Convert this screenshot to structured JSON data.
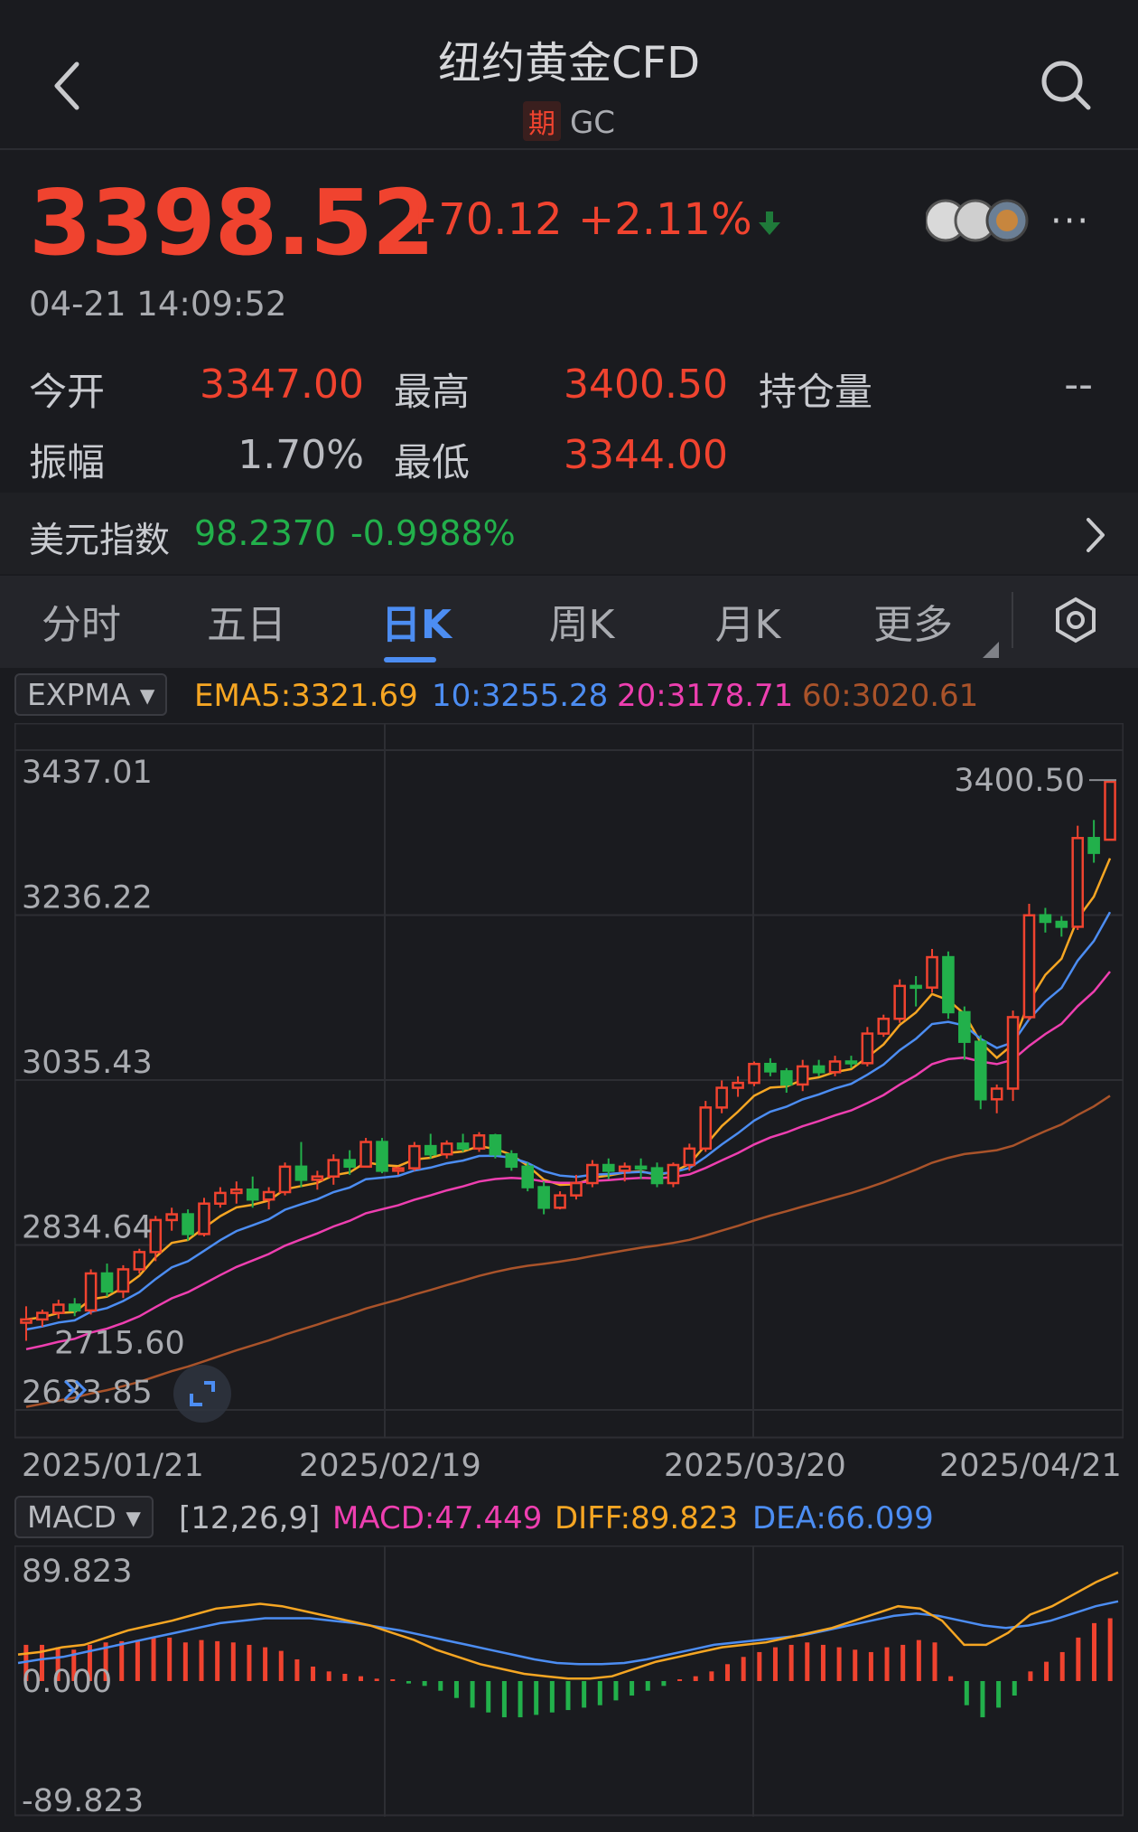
{
  "header": {
    "title": "纽约黄金CFD",
    "tag": "期",
    "code": "GC"
  },
  "quote": {
    "price": "3398.52",
    "change": "+70.12",
    "change_pct": "+2.11%",
    "time": "04-21 14:09:52",
    "more": "···"
  },
  "stats": {
    "open_label": "今开",
    "open": "3347.00",
    "high_label": "最高",
    "high": "3400.50",
    "oi_label": "持仓量",
    "oi": "--",
    "amp_label": "振幅",
    "amp": "1.70%",
    "low_label": "最低",
    "low": "3344.00"
  },
  "dxy": {
    "label": "美元指数",
    "value": "98.2370",
    "change": "-0.9988%"
  },
  "tabs": [
    {
      "label": "分时"
    },
    {
      "label": "五日"
    },
    {
      "label": "日K"
    },
    {
      "label": "周K"
    },
    {
      "label": "月K"
    },
    {
      "label": "更多"
    }
  ],
  "colors": {
    "up": "#f0432f",
    "down": "#22b04b",
    "accent": "#4c8df2",
    "ema5": "#f6a623",
    "ema10": "#4c8df2",
    "ema20": "#ee3fb0",
    "ema60": "#a9532a"
  },
  "expma": {
    "selector": "EXPMA",
    "ema5": "EMA5:3321.69",
    "ema10": "10:3255.28",
    "ema20": "20:3178.71",
    "ema60": "60:3020.61"
  },
  "chart_data": [
    {
      "type": "candlestick",
      "ylim": [
        2633.85,
        3437.01
      ],
      "y_ticks": [
        "3437.01",
        "3236.22",
        "3035.43",
        "2834.64",
        "2633.85"
      ],
      "x_ticks": [
        "2025/01/21",
        "2025/02/19",
        "2025/03/20",
        "2025/04/21"
      ],
      "max_label": "3400.50",
      "min_label": "2715.60",
      "candles": [
        [
          2740,
          2760,
          2718,
          2744
        ],
        [
          2744,
          2756,
          2735,
          2752
        ],
        [
          2752,
          2768,
          2745,
          2762
        ],
        [
          2762,
          2770,
          2748,
          2755
        ],
        [
          2755,
          2805,
          2750,
          2800
        ],
        [
          2800,
          2812,
          2772,
          2778
        ],
        [
          2778,
          2810,
          2770,
          2805
        ],
        [
          2805,
          2830,
          2800,
          2826
        ],
        [
          2826,
          2870,
          2815,
          2865
        ],
        [
          2865,
          2880,
          2852,
          2872
        ],
        [
          2872,
          2878,
          2840,
          2848
        ],
        [
          2848,
          2892,
          2845,
          2885
        ],
        [
          2885,
          2905,
          2880,
          2898
        ],
        [
          2898,
          2912,
          2885,
          2902
        ],
        [
          2902,
          2918,
          2880,
          2890
        ],
        [
          2890,
          2905,
          2878,
          2899
        ],
        [
          2899,
          2935,
          2895,
          2930
        ],
        [
          2930,
          2960,
          2905,
          2914
        ],
        [
          2914,
          2925,
          2902,
          2918
        ],
        [
          2918,
          2945,
          2908,
          2938
        ],
        [
          2938,
          2950,
          2920,
          2930
        ],
        [
          2930,
          2965,
          2930,
          2960
        ],
        [
          2960,
          2965,
          2922,
          2925
        ],
        [
          2925,
          2930,
          2920,
          2928
        ],
        [
          2928,
          2960,
          2925,
          2955
        ],
        [
          2955,
          2970,
          2940,
          2945
        ],
        [
          2945,
          2962,
          2940,
          2958
        ],
        [
          2958,
          2970,
          2948,
          2952
        ],
        [
          2952,
          2972,
          2948,
          2968
        ],
        [
          2968,
          2970,
          2940,
          2945
        ],
        [
          2945,
          2950,
          2925,
          2930
        ],
        [
          2930,
          2935,
          2900,
          2905
        ],
        [
          2905,
          2912,
          2872,
          2880
        ],
        [
          2880,
          2900,
          2878,
          2895
        ],
        [
          2895,
          2920,
          2890,
          2910
        ],
        [
          2910,
          2938,
          2905,
          2932
        ],
        [
          2932,
          2940,
          2915,
          2925
        ],
        [
          2925,
          2935,
          2912,
          2930
        ],
        [
          2930,
          2940,
          2915,
          2928
        ],
        [
          2928,
          2935,
          2905,
          2910
        ],
        [
          2910,
          2935,
          2905,
          2932
        ],
        [
          2932,
          2958,
          2925,
          2952
        ],
        [
          2952,
          3010,
          2948,
          3002
        ],
        [
          3002,
          3035,
          2995,
          3026
        ],
        [
          3026,
          3040,
          3015,
          3032
        ],
        [
          3032,
          3058,
          3028,
          3055
        ],
        [
          3055,
          3062,
          3040,
          3046
        ],
        [
          3046,
          3050,
          3020,
          3030
        ],
        [
          3030,
          3060,
          3022,
          3052
        ],
        [
          3052,
          3060,
          3040,
          3045
        ],
        [
          3045,
          3065,
          3040,
          3058
        ],
        [
          3058,
          3065,
          3050,
          3056
        ],
        [
          3056,
          3100,
          3052,
          3092
        ],
        [
          3092,
          3115,
          3088,
          3110
        ],
        [
          3110,
          3158,
          3105,
          3150
        ],
        [
          3150,
          3162,
          3125,
          3148
        ],
        [
          3148,
          3195,
          3142,
          3185
        ],
        [
          3185,
          3192,
          3110,
          3118
        ],
        [
          3118,
          3125,
          3060,
          3082
        ],
        [
          3082,
          3090,
          3000,
          3012
        ],
        [
          3012,
          3030,
          2995,
          3025
        ],
        [
          3025,
          3120,
          3010,
          3112
        ],
        [
          3112,
          3250,
          3108,
          3236
        ],
        [
          3236,
          3245,
          3215,
          3228
        ],
        [
          3228,
          3235,
          3210,
          3222
        ],
        [
          3222,
          3345,
          3218,
          3330
        ],
        [
          3330,
          3352,
          3300,
          3312
        ],
        [
          3328,
          3400.5,
          3344,
          3398.52
        ]
      ]
    },
    {
      "type": "bar",
      "title": "MACD",
      "selector": "MACD",
      "params": "[12,26,9]",
      "macd": "MACD:47.449",
      "diff": "DIFF:89.823",
      "dea": "DEA:66.099",
      "ylim": [
        -89.823,
        89.823
      ],
      "y_ticks": [
        "89.823",
        "0.000",
        "-89.823"
      ],
      "values": [
        30,
        30,
        28,
        26,
        30,
        32,
        33,
        34,
        36,
        36,
        32,
        34,
        33,
        32,
        30,
        28,
        25,
        18,
        12,
        8,
        6,
        4,
        2,
        0,
        -2,
        -4,
        -8,
        -14,
        -22,
        -26,
        -30,
        -30,
        -28,
        -26,
        -24,
        -22,
        -20,
        -16,
        -12,
        -8,
        -4,
        0,
        4,
        8,
        14,
        20,
        24,
        28,
        30,
        32,
        30,
        28,
        26,
        24,
        28,
        30,
        34,
        32,
        4,
        -20,
        -30,
        -22,
        -12,
        8,
        16,
        24,
        36,
        48,
        52
      ],
      "diff_series": [
        22,
        24,
        28,
        30,
        36,
        42,
        46,
        50,
        55,
        60,
        62,
        64,
        62,
        58,
        54,
        50,
        46,
        40,
        34,
        26,
        20,
        14,
        10,
        6,
        4,
        2,
        2,
        4,
        10,
        16,
        20,
        24,
        28,
        30,
        32,
        36,
        40,
        44,
        50,
        56,
        62,
        60,
        50,
        30,
        30,
        40,
        55,
        62,
        72,
        82,
        90
      ],
      "dea_series": [
        15,
        18,
        20,
        24,
        28,
        32,
        36,
        40,
        44,
        48,
        50,
        52,
        52,
        52,
        50,
        48,
        45,
        42,
        38,
        34,
        30,
        26,
        22,
        18,
        15,
        14,
        14,
        15,
        18,
        22,
        26,
        30,
        32,
        34,
        36,
        38,
        42,
        46,
        50,
        54,
        56,
        54,
        50,
        46,
        44,
        46,
        50,
        56,
        62,
        66
      ]
    }
  ]
}
